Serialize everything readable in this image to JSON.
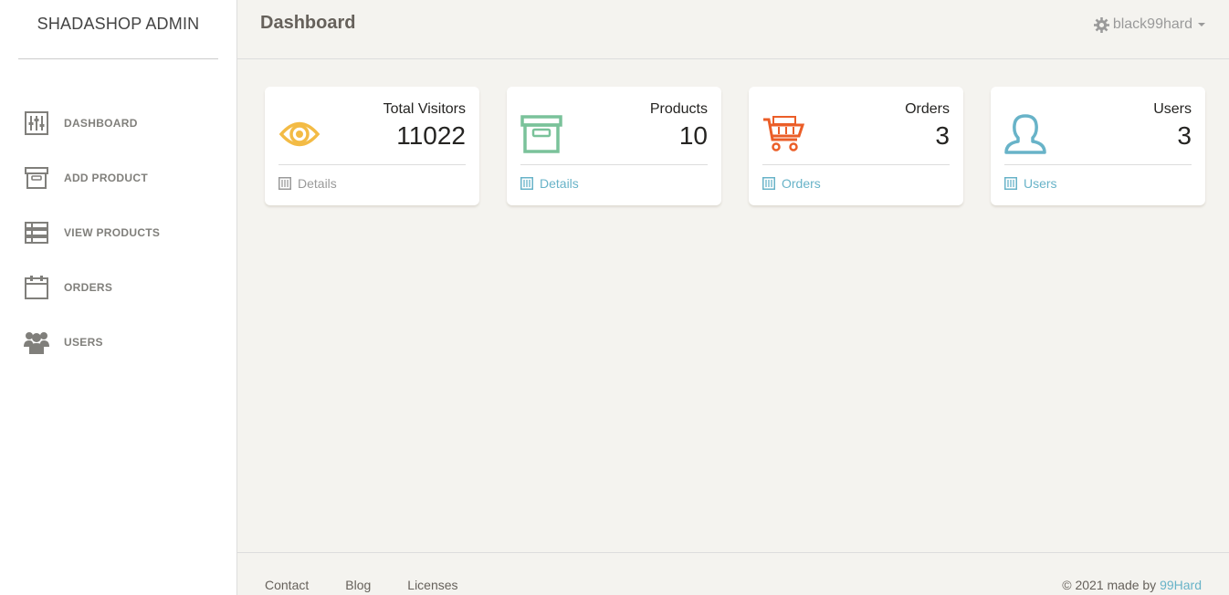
{
  "brand": "SHADASHOP ADMIN",
  "nav": [
    {
      "label": "DASHBOARD",
      "icon": "sliders-icon"
    },
    {
      "label": "ADD PRODUCT",
      "icon": "archive-icon"
    },
    {
      "label": "VIEW PRODUCTS",
      "icon": "list-icon"
    },
    {
      "label": "ORDERS",
      "icon": "calendar-icon"
    },
    {
      "label": "USERS",
      "icon": "users-icon"
    }
  ],
  "header": {
    "title": "Dashboard",
    "user": "black99hard"
  },
  "cards": [
    {
      "label": "Total Visitors",
      "value": "11022",
      "link": "Details",
      "icon": "eye-icon",
      "color": "#f3bb45",
      "link_color": "#9a9a9a"
    },
    {
      "label": "Products",
      "value": "10",
      "link": "Details",
      "icon": "box-icon",
      "color": "#7ac29a",
      "link_color": "#68b3c8"
    },
    {
      "label": "Orders",
      "value": "3",
      "link": "Orders",
      "icon": "cart-icon",
      "color": "#eb5e28",
      "link_color": "#68b3c8"
    },
    {
      "label": "Users",
      "value": "3",
      "link": "Users",
      "icon": "user-icon",
      "color": "#68b3c8",
      "link_color": "#68b3c8"
    }
  ],
  "footer": {
    "links": [
      "Contact",
      "Blog",
      "Licenses"
    ],
    "copyright_prefix": "© 2021 made by ",
    "copyright_brand": "99Hard"
  }
}
